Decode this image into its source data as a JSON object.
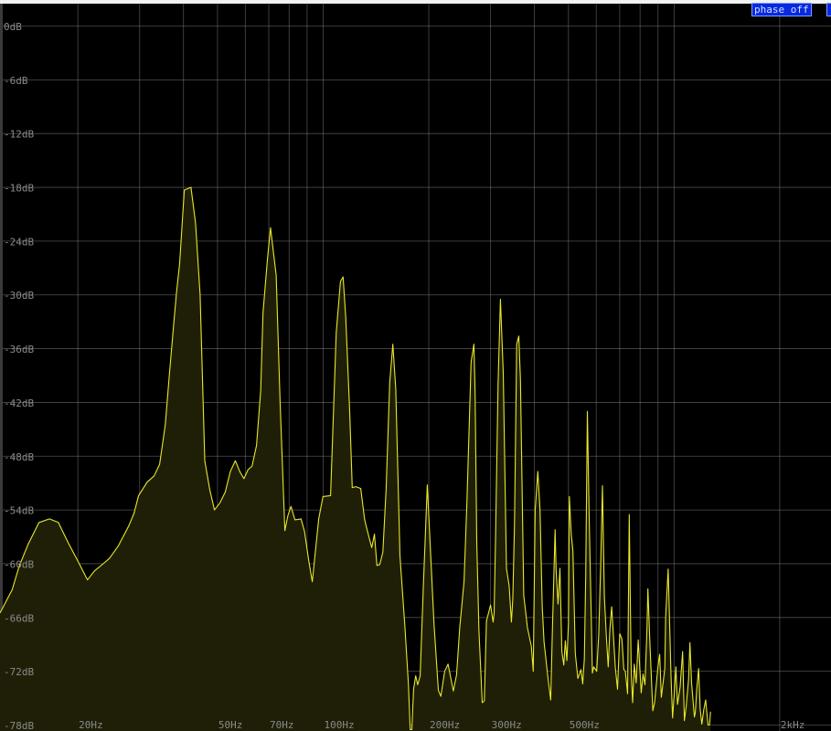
{
  "controls": {
    "phase_button_label": "phase off"
  },
  "colors": {
    "background": "#000000",
    "grid": "#8a8a8a",
    "label": "#8a8a8a",
    "curve": "#e8e82a",
    "fill": "#1f1f08",
    "button_bg": "#0a28e0"
  },
  "chart_data": {
    "type": "area",
    "xscale": "log",
    "xlim": [
      12,
      2800
    ],
    "ylim": [
      -78,
      0
    ],
    "grid": true,
    "y_ticks": [
      0,
      -6,
      -12,
      -18,
      -24,
      -30,
      -36,
      -42,
      -48,
      -54,
      -60,
      -66,
      -72,
      -78
    ],
    "y_tick_labels": [
      "0dB",
      "-6dB",
      "-12dB",
      "-18dB",
      "-24dB",
      "-30dB",
      "-36dB",
      "-42dB",
      "-48dB",
      "-54dB",
      "-60dB",
      "-66dB",
      "-72dB",
      "-78dB"
    ],
    "x_grid_values": [
      20,
      30,
      40,
      50,
      60,
      70,
      80,
      90,
      100,
      200,
      300,
      400,
      500,
      600,
      700,
      800,
      900,
      1000,
      2000
    ],
    "x_tick_values": [
      20,
      50,
      70,
      100,
      200,
      300,
      500,
      2000
    ],
    "x_tick_labels": [
      "20Hz",
      "50Hz",
      "70Hz",
      "100Hz",
      "200Hz",
      "300Hz",
      "500Hz",
      "2kHz"
    ],
    "series": [
      {
        "x": [
          12,
          13,
          13.6,
          14.4,
          15.5,
          16.6,
          17.6,
          18.8,
          20,
          21.3,
          22.3,
          23.6,
          24.6,
          26.1,
          27.9,
          28.9,
          29.8,
          31.5,
          33,
          34.2,
          35.5,
          36.4,
          37.6,
          38.2,
          39,
          40.2,
          42,
          43.3,
          44.6,
          46,
          47.5,
          49,
          50.8,
          52.6,
          54.4,
          56.2,
          58,
          59.5,
          61.1,
          62.7,
          64.6,
          66.4,
          67.4,
          69.3,
          70.8,
          73.5,
          75.4,
          77.8,
          79.4,
          81,
          83.1,
          86.5,
          88.5,
          91,
          93.1,
          97.1,
          99.9,
          105,
          109,
          112,
          114,
          116,
          119,
          121,
          124,
          128,
          131.3,
          134,
          137.5,
          140,
          142.3,
          145,
          148,
          151.2,
          154.8,
          158,
          161,
          165.5,
          171,
          175,
          177,
          179,
          181,
          183.5,
          186,
          189,
          193,
          198,
          207,
          213,
          216.5,
          222,
          227,
          235,
          240,
          245,
          252,
          257,
          264,
          269,
          271,
          274,
          278,
          284,
          288,
          292,
          300,
          305,
          307,
          310,
          315,
          320,
          326,
          333,
          339,
          344,
          347,
          351,
          356,
          361,
          365,
          373,
          382,
          392,
          397,
          402,
          409,
          415,
          421,
          426,
          438,
          445,
          450,
          458,
          461,
          467,
          473,
          479,
          485,
          490,
          495,
          500,
          503,
          509,
          515,
          523,
          532,
          543,
          549,
          555,
          560,
          566,
          573,
          579,
          585,
          590,
          602,
          610,
          618,
          625,
          633,
          641,
          649,
          656,
          664,
          680,
          690,
          700,
          710,
          719,
          726,
          737,
          745,
          755,
          762,
          770,
          780,
          790,
          806,
          816,
          826,
          837,
          842,
          854,
          870,
          880,
          900,
          910,
          920,
          941,
          946,
          962,
          980,
          990,
          1000,
          1012,
          1023,
          1040,
          1058,
          1070,
          1082,
          1100,
          1110,
          1122,
          1143,
          1150,
          1160,
          1175,
          1187,
          1200,
          1215,
          1230,
          1250,
          1262,
          1270
        ],
        "y": [
          -65.5,
          -62.9,
          -60.3,
          -57.9,
          -55.4,
          -55,
          -55.4,
          -57.7,
          -59.7,
          -61.8,
          -60.8,
          -60,
          -59.4,
          -58,
          -55.8,
          -54.4,
          -52.4,
          -50.9,
          -50.2,
          -48.9,
          -44.5,
          -39.2,
          -32.8,
          -29.8,
          -26.5,
          -18.3,
          -18,
          -22,
          -30,
          -48.5,
          -51.7,
          -54,
          -53.2,
          -52,
          -49.7,
          -48.5,
          -49.8,
          -50.5,
          -49.5,
          -49.1,
          -46.8,
          -40.6,
          -32,
          -26.3,
          -22.5,
          -27.8,
          -42,
          -56.3,
          -54.6,
          -53.6,
          -55.1,
          -55,
          -56.4,
          -59.7,
          -62,
          -55,
          -52.5,
          -52.4,
          -34.2,
          -28.5,
          -28,
          -32.5,
          -43,
          -51.5,
          -51.4,
          -51.6,
          -55.1,
          -56.5,
          -58.2,
          -56.7,
          -60.2,
          -60.1,
          -58.7,
          -51.6,
          -39.8,
          -35.5,
          -40.5,
          -59.1,
          -67,
          -73.5,
          -78.5,
          -78.5,
          -74,
          -72.5,
          -73.5,
          -72.5,
          -62.5,
          -51.2,
          -66.8,
          -74.1,
          -74.8,
          -72,
          -71.2,
          -74.2,
          -72.4,
          -67.1,
          -62,
          -53,
          -37.5,
          -35.5,
          -41,
          -57.5,
          -67.5,
          -75.5,
          -75.3,
          -66.4,
          -64.6,
          -66.5,
          -65.5,
          -57,
          -40,
          -30.5,
          -38.7,
          -60.5,
          -62.5,
          -66.5,
          -64,
          -55.6,
          -35.5,
          -34.6,
          -39.5,
          -63.5,
          -67.1,
          -69.2,
          -72,
          -54,
          -49.7,
          -54,
          -64.7,
          -68.7,
          -73,
          -75.2,
          -67.6,
          -56.2,
          -60.7,
          -64.5,
          -60.5,
          -69.8,
          -71.3,
          -68.6,
          -70.8,
          -66.7,
          -52.5,
          -56.6,
          -58.6,
          -70,
          -72.8,
          -71.8,
          -73.4,
          -70.6,
          -61.4,
          -43,
          -55,
          -63.2,
          -72.2,
          -71.5,
          -72,
          -68,
          -60,
          -51.3,
          -63.6,
          -68,
          -71.5,
          -67.3,
          -64.8,
          -71.6,
          -74,
          -67.8,
          -68.4,
          -71.8,
          -72,
          -74.5,
          -54.5,
          -72.3,
          -75.5,
          -71.2,
          -73.3,
          -68.5,
          -74.4,
          -72.3,
          -73.5,
          -67.3,
          -62.8,
          -69.1,
          -76.4,
          -75.5,
          -71.4,
          -70.1,
          -74.9,
          -71.7,
          -66,
          -60.6,
          -72.5,
          -77.2,
          -74.8,
          -71.5,
          -75.7,
          -73.8,
          -69.8,
          -77.5,
          -76,
          -72.9,
          -68.8,
          -73.3,
          -77.1,
          -76.6,
          -74,
          -71.7,
          -76.2,
          -77.9,
          -76.3,
          -75.2,
          -78,
          -78,
          -76.5
        ]
      }
    ]
  }
}
